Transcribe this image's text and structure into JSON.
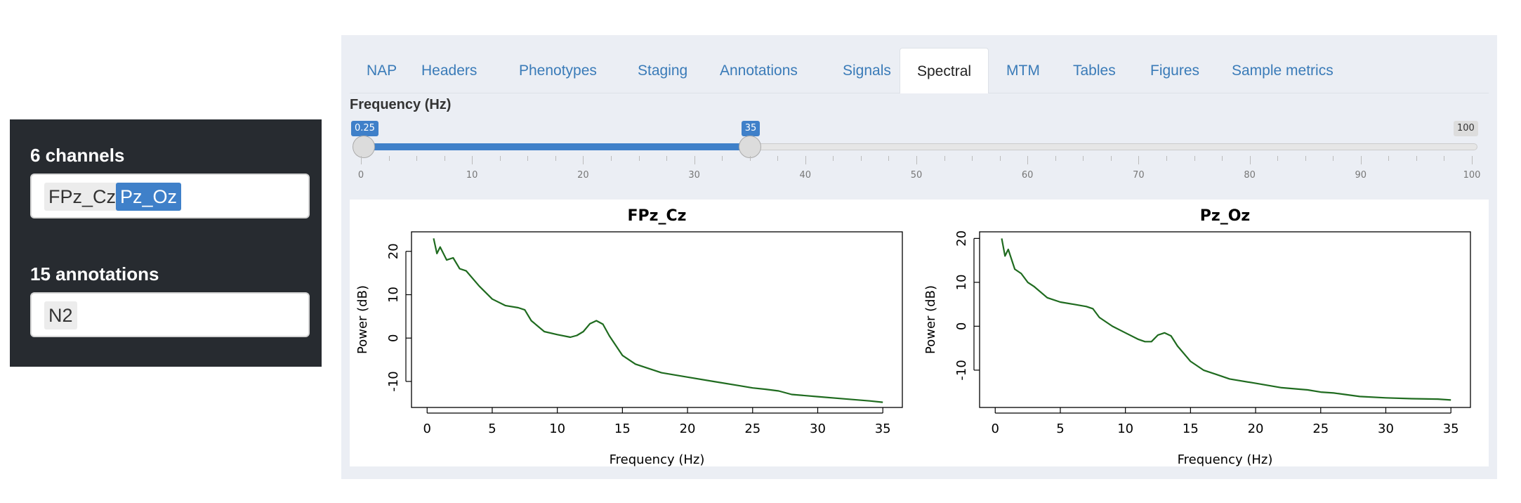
{
  "sidebar": {
    "channels_title": "6 channels",
    "channels": [
      {
        "label": "FPz_Cz",
        "selected": false
      },
      {
        "label": "Pz_Oz",
        "selected": true
      }
    ],
    "annotations_title": "15 annotations",
    "annotations": [
      {
        "label": "N2",
        "selected": false
      }
    ]
  },
  "tabs": [
    {
      "label": "NAP",
      "active": false
    },
    {
      "label": "Headers",
      "active": false
    },
    {
      "label": "Phenotypes",
      "active": false
    },
    {
      "label": "Staging",
      "active": false
    },
    {
      "label": "Annotations",
      "active": false
    },
    {
      "label": "Signals",
      "active": false
    },
    {
      "label": "Spectral",
      "active": true
    },
    {
      "label": "MTM",
      "active": false
    },
    {
      "label": "Tables",
      "active": false
    },
    {
      "label": "Figures",
      "active": false
    },
    {
      "label": "Sample metrics",
      "active": false
    }
  ],
  "frequency_slider": {
    "label": "Frequency (Hz)",
    "min": 0,
    "max": 100,
    "from": 0.25,
    "to": 35,
    "from_label": "0.25",
    "to_label": "35",
    "max_label": "100",
    "grid_labels": [
      "0",
      "10",
      "20",
      "30",
      "40",
      "50",
      "60",
      "70",
      "80",
      "90",
      "100"
    ]
  },
  "colors": {
    "accent": "#3f80c9",
    "line": "#1f6b1f",
    "sidebar_bg": "#272b30"
  },
  "chart_data": [
    {
      "type": "line",
      "title": "FPz_Cz",
      "xlabel": "Frequency (Hz)",
      "ylabel": "Power (dB)",
      "xlim": [
        -1.2,
        36.5
      ],
      "ylim": [
        -16,
        24.5
      ],
      "xticks": [
        0,
        5,
        10,
        15,
        20,
        25,
        30,
        35
      ],
      "yticks": [
        -10,
        0,
        10,
        20
      ],
      "x": [
        0.5,
        0.75,
        1,
        1.5,
        2,
        2.5,
        3,
        4,
        5,
        6,
        7,
        7.5,
        8,
        9,
        10,
        11,
        11.5,
        12,
        12.5,
        13,
        13.5,
        14,
        15,
        16,
        17,
        18,
        20,
        22,
        24,
        25,
        26,
        27,
        28,
        30,
        32,
        34,
        35
      ],
      "y": [
        23,
        19.5,
        21,
        18,
        18.5,
        16,
        15.5,
        12,
        9,
        7.5,
        7,
        6.5,
        4,
        1.5,
        0.8,
        0.2,
        0.6,
        1.5,
        3.3,
        4,
        3.2,
        0.5,
        -4,
        -6,
        -7,
        -8,
        -9,
        -10,
        -11,
        -11.5,
        -11.8,
        -12.2,
        -13,
        -13.5,
        -14,
        -14.5,
        -14.8
      ]
    },
    {
      "type": "line",
      "title": "Pz_Oz",
      "xlabel": "Frequency (Hz)",
      "ylabel": "Power (dB)",
      "xlim": [
        -1.2,
        36.5
      ],
      "ylim": [
        -18.5,
        21.5
      ],
      "xticks": [
        0,
        5,
        10,
        15,
        20,
        25,
        30,
        35
      ],
      "yticks": [
        -10,
        0,
        10,
        20
      ],
      "x": [
        0.5,
        0.75,
        1,
        1.5,
        2,
        2.5,
        3,
        4,
        5,
        6,
        7,
        7.5,
        8,
        9,
        10,
        11,
        11.5,
        12,
        12.5,
        13,
        13.5,
        14,
        15,
        16,
        17,
        18,
        20,
        22,
        24,
        25,
        26,
        27,
        28,
        30,
        32,
        34,
        35
      ],
      "y": [
        20,
        16,
        17.5,
        13,
        12,
        10,
        9,
        6.5,
        5.5,
        5,
        4.5,
        4,
        2,
        0,
        -1.5,
        -3,
        -3.5,
        -3.5,
        -2,
        -1.5,
        -2.2,
        -4.5,
        -8,
        -10,
        -11,
        -12,
        -13,
        -14,
        -14.5,
        -15,
        -15.2,
        -15.6,
        -16,
        -16.3,
        -16.5,
        -16.6,
        -16.8
      ]
    }
  ]
}
